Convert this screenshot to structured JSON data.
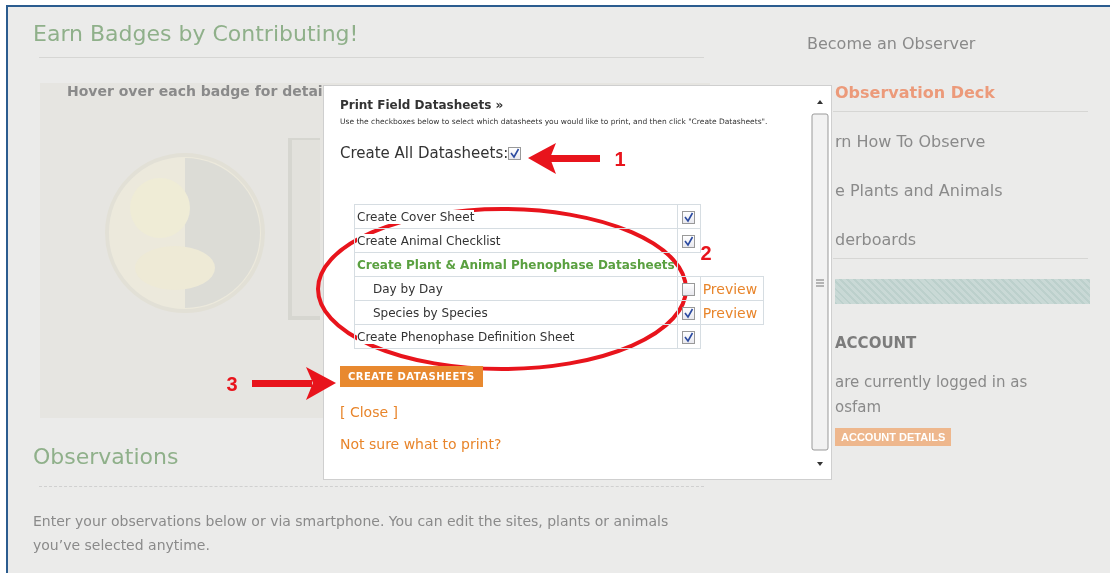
{
  "page": {
    "title": "Earn Badges by Contributing!",
    "badge_hint": "Hover over each badge for detai",
    "observations_title": "Observations",
    "observations_text": "Enter your observations below or via smartphone. You can edit the sites, plants or animals you’ve selected anytime."
  },
  "sidebar": {
    "items": [
      {
        "label": "Become an Observer",
        "selected": false
      },
      {
        "label": "Observation Deck",
        "selected": true
      },
      {
        "label": "rn How To Observe",
        "selected": false
      },
      {
        "label": "e Plants and Animals",
        "selected": false
      },
      {
        "label": "derboards",
        "selected": false
      }
    ],
    "account": {
      "title": "ACCOUNT",
      "text": "are currently logged in as",
      "user": "osfam",
      "button": "ACCOUNT DETAILS"
    }
  },
  "dialog": {
    "title": "Print Field Datasheets »",
    "instructions": "Use the checkboxes below to select which datasheets you would like to print, and then click \"Create Datasheets\".",
    "all_label": "Create All Datasheets:",
    "all_checked": true,
    "options": [
      {
        "kind": "option",
        "label": "Create Cover Sheet",
        "checked": true
      },
      {
        "kind": "option",
        "label": "Create Animal Checklist",
        "checked": true
      },
      {
        "kind": "group",
        "label": "Create Plant & Animal Phenophase Datasheets",
        "children": [
          {
            "label": "Day by Day",
            "checked": false,
            "link": "Preview"
          },
          {
            "label": "Species by Species",
            "checked": true,
            "link": "Preview"
          }
        ]
      },
      {
        "kind": "option",
        "label": "Create Phenophase Definition Sheet",
        "checked": true
      }
    ],
    "button": "CREATE DATASHEETS",
    "close": "[ Close ]",
    "help": "Not sure what to print?"
  },
  "annotations": [
    {
      "label": "1"
    },
    {
      "label": "2"
    },
    {
      "label": "3"
    }
  ]
}
